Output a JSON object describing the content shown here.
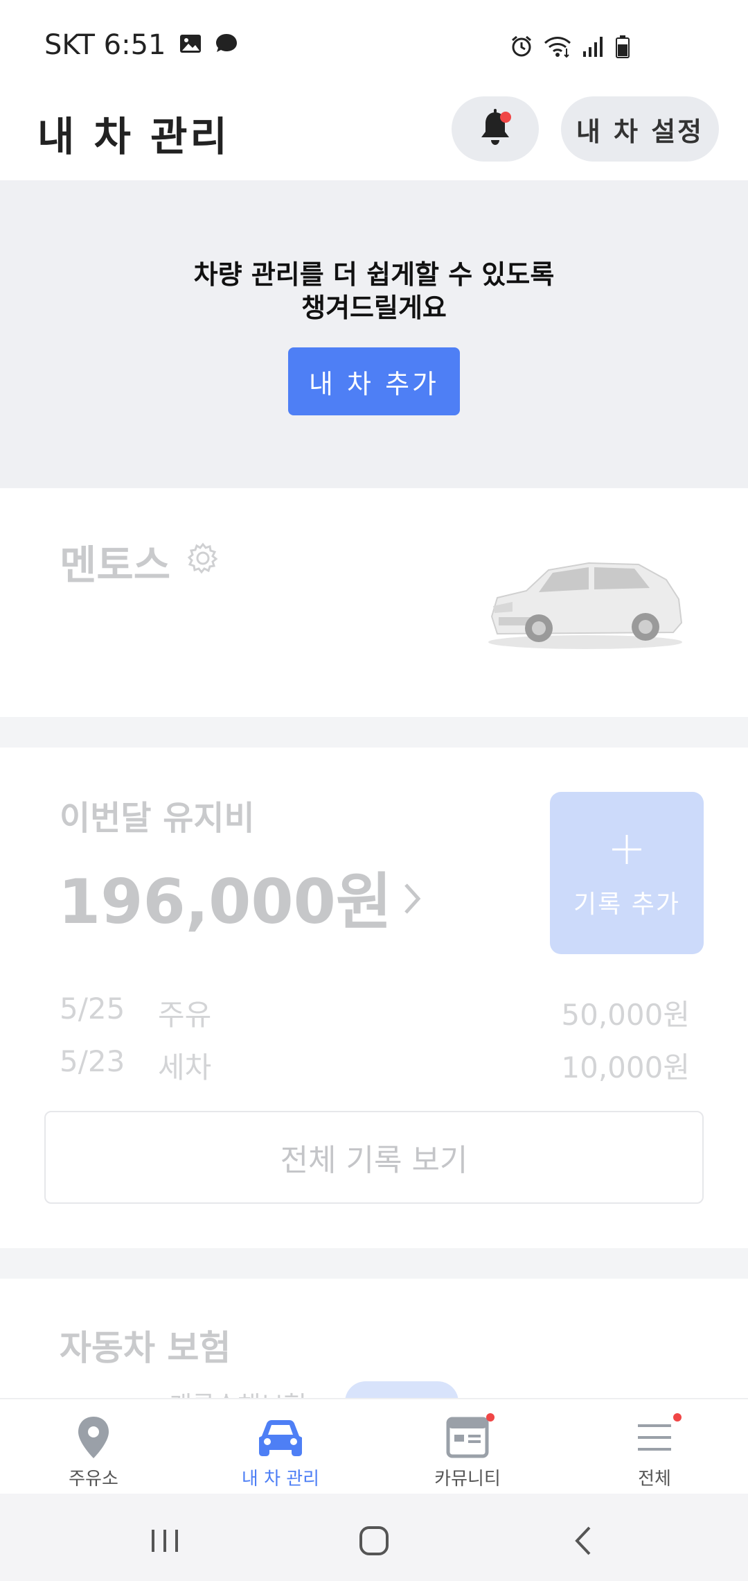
{
  "status_bar": {
    "carrier_time": "SKT 6:51",
    "left_icons": [
      "gallery-icon",
      "chat-bubble-icon"
    ],
    "right_icons": [
      "alarm-icon",
      "wifi-icon",
      "signal-icon",
      "battery-icon"
    ]
  },
  "header": {
    "title": "내 차 관리",
    "bell_icon": "bell-icon",
    "settings_label": "내 차 설정"
  },
  "promo": {
    "line1": "차량 관리를 더 쉽게할 수 있도록",
    "line2": "챙겨드릴게요",
    "button_label": "내 차 추가",
    "button_color": "#4e7ff5"
  },
  "car": {
    "name": "멘토스",
    "settings_icon": "gear-icon"
  },
  "monthly_cost": {
    "title": "이번달 유지비",
    "amount": "196,000원",
    "add_record_label": "기록 추가",
    "records": [
      {
        "date": "5/25",
        "type": "주유",
        "amount": "50,000원"
      },
      {
        "date": "5/23",
        "type": "세차",
        "amount": "10,000원"
      }
    ],
    "view_all_label": "전체 기록 보기"
  },
  "insurance": {
    "title": "자동차 보험",
    "subtitle": "캐롯손해보험"
  },
  "bottom_nav": {
    "items": [
      {
        "label": "주유소",
        "icon": "location-pin-icon",
        "active": false
      },
      {
        "label": "내 차 관리",
        "icon": "car-icon",
        "active": true
      },
      {
        "label": "카뮤니티",
        "icon": "community-board-icon",
        "active": false
      },
      {
        "label": "전체",
        "icon": "menu-icon",
        "active": false
      }
    ]
  }
}
